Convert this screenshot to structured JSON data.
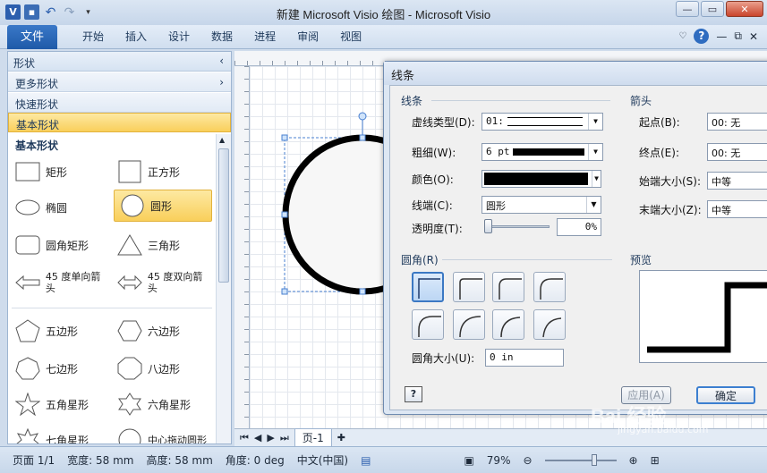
{
  "window": {
    "title": "新建 Microsoft Visio 绘图 - Microsoft Visio",
    "app_icon": "V"
  },
  "qat": {
    "save": "save-icon",
    "undo": "undo-icon",
    "redo": "redo-icon"
  },
  "ribbon": {
    "file_tab": "文件",
    "tabs": [
      "开始",
      "插入",
      "设计",
      "数据",
      "进程",
      "审阅",
      "视图"
    ]
  },
  "shapes_pane": {
    "title": "形状",
    "more_shapes": "更多形状",
    "quick_shapes": "快速形状",
    "basic_shapes": "基本形状",
    "stencil_title": "基本形状",
    "items": [
      {
        "label": "矩形",
        "icon": "rectangle-icon"
      },
      {
        "label": "正方形",
        "icon": "square-icon"
      },
      {
        "label": "椭圆",
        "icon": "ellipse-icon"
      },
      {
        "label": "圆形",
        "icon": "circle-icon",
        "selected": true
      },
      {
        "label": "圆角矩形",
        "icon": "rounded-rectangle-icon"
      },
      {
        "label": "三角形",
        "icon": "triangle-icon"
      },
      {
        "label": "45 度单向箭头",
        "icon": "single-arrow-icon"
      },
      {
        "label": "45 度双向箭头",
        "icon": "double-arrow-icon"
      },
      {
        "label": "五边形",
        "icon": "pentagon-icon"
      },
      {
        "label": "六边形",
        "icon": "hexagon-icon"
      },
      {
        "label": "七边形",
        "icon": "heptagon-icon"
      },
      {
        "label": "八边形",
        "icon": "octagon-icon"
      },
      {
        "label": "五角星形",
        "icon": "star5-icon"
      },
      {
        "label": "六角星形",
        "icon": "star6-icon"
      },
      {
        "label": "七角星形",
        "icon": "star7-icon"
      },
      {
        "label": "中心拖动圆形",
        "icon": "center-drag-circle-icon"
      }
    ]
  },
  "page_tab": "页-1",
  "status": {
    "page": "页面 1/1",
    "width": "宽度: 58 mm",
    "height": "高度: 58 mm",
    "angle": "角度: 0 deg",
    "language": "中文(中国)",
    "zoom": "79%"
  },
  "dialog": {
    "title": "线条",
    "line_group": "线条",
    "dash_type_label": "虚线类型(D):",
    "dash_type_value": "01:",
    "weight_label": "粗细(W):",
    "weight_value": "6 pt",
    "color_label": "颜色(O):",
    "cap_label": "线端(C):",
    "cap_value": "圆形",
    "transparency_label": "透明度(T):",
    "transparency_value": "0%",
    "arrow_group": "箭头",
    "start_label": "起点(B):",
    "start_value": "00: 无",
    "end_label": "终点(E):",
    "end_value": "00: 无",
    "start_size_label": "始端大小(S):",
    "start_size_value": "中等",
    "end_size_label": "末端大小(Z):",
    "end_size_value": "中等",
    "corner_group": "圆角(R)",
    "corner_size_label": "圆角大小(U):",
    "corner_size_value": "0 in",
    "preview_label": "预览",
    "apply_button": "应用(A)",
    "ok_button": "确定",
    "line_color": "#000000"
  },
  "watermark": {
    "text": "Bai 经验",
    "url": "jingyan.baidu.com"
  }
}
